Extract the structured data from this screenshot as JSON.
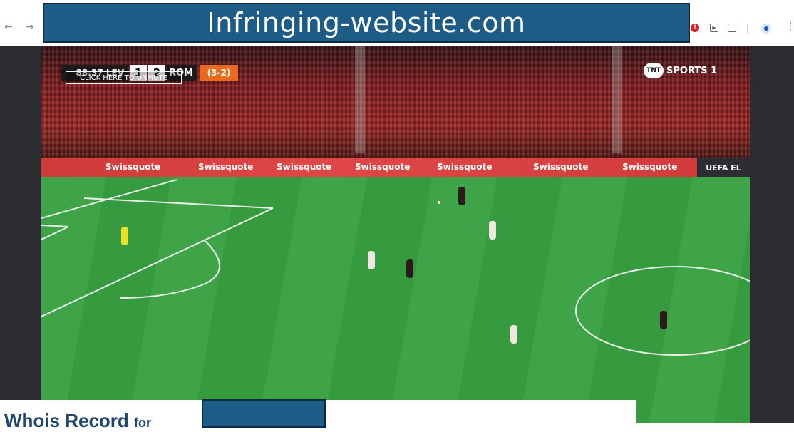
{
  "browser": {
    "back_icon": "←",
    "forward_icon": "→",
    "url_banner_text": "Infringing-website.com",
    "alert_badge": "!",
    "menu_icon": "⋮",
    "icons": [
      "arrow-left-icon",
      "arrow-right-icon",
      "alert-icon",
      "media-control-icon",
      "extensions-icon",
      "profile-icon",
      "kebab-menu-icon"
    ]
  },
  "video": {
    "clock": "88:37",
    "home_team": "LEV",
    "home_score": "1",
    "away_score": "2",
    "away_team": "ROM",
    "aggregate": "(3-2)",
    "unmute_label": "CLICK HERE TO UNMUTE",
    "broadcaster": "SPORTS 1",
    "broadcaster_logo": "TNT",
    "ad_board": [
      "Swissquote",
      "Swissquote",
      "Swissquote",
      "Swissquote",
      "Swissquote",
      "Swissquote",
      "Swissquote"
    ],
    "uefa_label": "UEFA EL"
  },
  "whois": {
    "title": "Whois Record",
    "for_label": "for"
  },
  "colors": {
    "banner_bg": "#1d5c86",
    "score_orange": "#e86a1a",
    "whois_title": "#20466e"
  }
}
